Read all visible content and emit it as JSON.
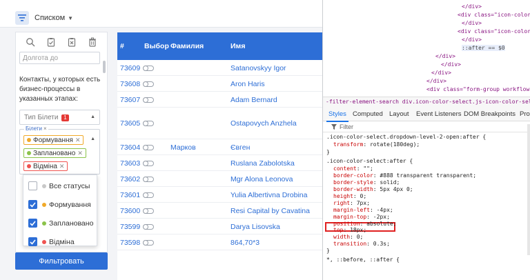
{
  "topbar": {
    "view_label": "Списком"
  },
  "filter_panel": {
    "date_placeholder": "Долгота до",
    "contacts_text": "Контакты, у которых есть бизнес-процессы в указанных этапах:",
    "type_select": {
      "label": "Тип Білети",
      "badge": "1"
    },
    "tags_legend": "Білети",
    "tags_legend_x": "×",
    "tags": [
      {
        "label": "Формування",
        "color": "#f0a929"
      },
      {
        "label": "Заплановано",
        "color": "#8bc34a"
      },
      {
        "label": "Відміна",
        "color": "#ef5350"
      }
    ],
    "status_menu": [
      {
        "label": "Все статусы",
        "checked": false,
        "color": "#c8c8c8"
      },
      {
        "label": "Формування",
        "checked": true,
        "color": "#f0a929"
      },
      {
        "label": "Заплановано",
        "checked": true,
        "color": "#8bc34a"
      },
      {
        "label": "Відміна",
        "checked": true,
        "color": "#ef5350"
      }
    ],
    "filter_button": "Фильтровать"
  },
  "table": {
    "headers": {
      "id": "#",
      "choice": "Выбор",
      "surname": "Фамилия",
      "name": "Имя"
    },
    "rows": [
      {
        "id": "73609",
        "surname": "",
        "name": "Satanovskyy Igor"
      },
      {
        "id": "73608",
        "surname": "",
        "name": "Aron Haris"
      },
      {
        "id": "73607",
        "surname": "",
        "name": "Adam Bernard"
      },
      {
        "id": "73605",
        "surname": "",
        "name": "Ostapovych Anzhela"
      },
      {
        "id": "73604",
        "surname": "Марков",
        "name": "Євген"
      },
      {
        "id": "73603",
        "surname": "",
        "name": "Ruslana Zabolotska"
      },
      {
        "id": "73602",
        "surname": "",
        "name": "Mgr Alona Leonova"
      },
      {
        "id": "73601",
        "surname": "",
        "name": "Yulia Albertivna Drobina"
      },
      {
        "id": "73600",
        "surname": "",
        "name": "Resi Capital by Cavatina"
      },
      {
        "id": "73599",
        "surname": "",
        "name": "Darya Lisovska"
      },
      {
        "id": "73598",
        "surname": "",
        "name": "864,70*3"
      }
    ]
  },
  "devtools": {
    "dom_lines": [
      "</div>",
      "<div class=\"icon-color-select",
      "</div>",
      "<div class=\"icon-color-select",
      "</div>",
      "::after == $0",
      "</div>",
      "</div>",
      "</div>",
      "</div>",
      "<div class=\"form-group workflow-"
    ],
    "breadcrumb": "-filter-element-search   div.icon-color-select.js-icon-color-select.dropdown-lev",
    "tabs": [
      "Styles",
      "Computed",
      "Layout",
      "Event Listeners",
      "DOM Breakpoints",
      "Prop"
    ],
    "filter_placeholder": "Filter",
    "css_lines": [
      ".icon-color-select.dropdown-level-2-open:after {",
      "transform: rotate(180deg);",
      "}",
      ".icon-color-select:after {",
      "content: \"\";",
      "border-color: #888 transparent transparent;",
      "border-style: solid;",
      "border-width: 5px 4px 0;",
      "height: 0;",
      "right: 7px;",
      "margin-left: -4px;",
      "margin-top: -2px;",
      "position: absolute;",
      "top: 18px;",
      "width: 0;",
      "transition: 0.3s;",
      "}",
      "*, ::before, ::after {"
    ]
  }
}
